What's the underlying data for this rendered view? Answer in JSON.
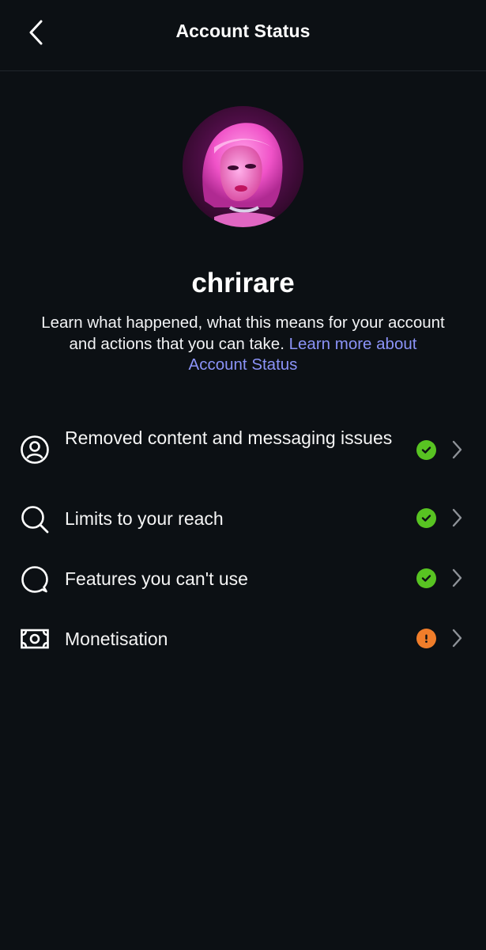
{
  "header": {
    "title": "Account Status"
  },
  "profile": {
    "username": "chrirare",
    "description_text": "Learn what happened, what this means for your account and actions that you can take.",
    "description_link": "Learn more about Account Status"
  },
  "colors": {
    "background": "#0c1014",
    "link": "#8b93f8",
    "status_ok": "#58c322",
    "status_warning": "#f07d2a",
    "chevron": "#8e9298"
  },
  "items": [
    {
      "label": "Removed content and messaging issues",
      "icon": "user-circle-icon",
      "status": "ok"
    },
    {
      "label": "Limits to your reach",
      "icon": "search-icon",
      "status": "ok"
    },
    {
      "label": "Features you can't use",
      "icon": "speech-bubble-icon",
      "status": "ok"
    },
    {
      "label": "Monetisation",
      "icon": "banknote-icon",
      "status": "warning"
    }
  ]
}
